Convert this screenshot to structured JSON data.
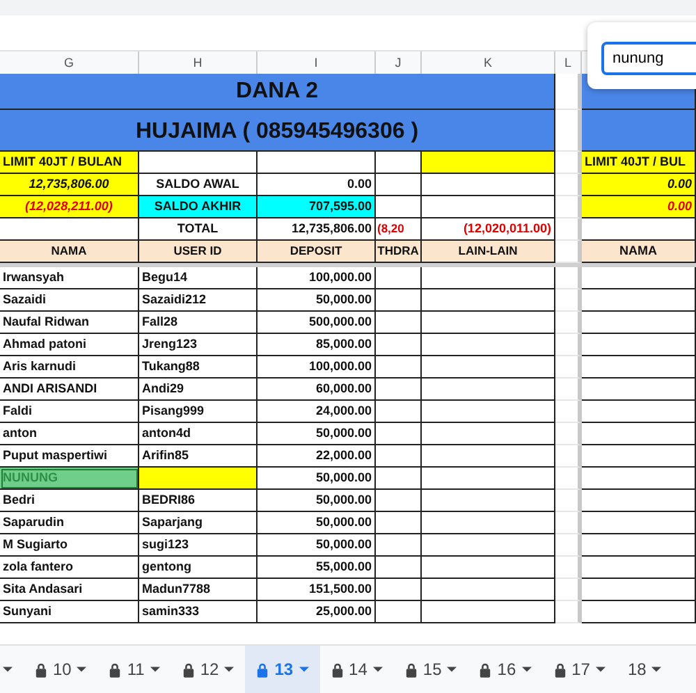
{
  "columns": [
    "G",
    "H",
    "I",
    "J",
    "K",
    "L"
  ],
  "title": "DANA 2",
  "subtitle": "HUJAIMA ( 085945496306 )",
  "limit": "LIMIT 40JT / BULAN",
  "balance_rows": [
    {
      "amount": "12,735,806.00",
      "negative": false,
      "label": "SALDO AWAL",
      "highlight": false,
      "value": "0.00"
    },
    {
      "amount": "(12,028,211.00)",
      "negative": true,
      "label": "SALDO AKHIR",
      "highlight": true,
      "value": "707,595.00"
    }
  ],
  "total": {
    "label": "TOTAL",
    "value": "12,735,806.00",
    "withdraw": "(8,20",
    "other": "(12,020,011.00)"
  },
  "headers": [
    "NAMA",
    "USER ID",
    "DEPOSIT",
    "THDRA",
    "LAIN-LAIN"
  ],
  "rows": [
    {
      "name": "Irwansyah",
      "user_id": "Begu14",
      "deposit": "100,000.00",
      "selected": false,
      "flagged": false
    },
    {
      "name": "Sazaidi",
      "user_id": "Sazaidi212",
      "deposit": "50,000.00",
      "selected": false,
      "flagged": false
    },
    {
      "name": "Naufal Ridwan",
      "user_id": "Fall28",
      "deposit": "500,000.00",
      "selected": false,
      "flagged": false
    },
    {
      "name": "Ahmad patoni",
      "user_id": "Jreng123",
      "deposit": "85,000.00",
      "selected": false,
      "flagged": false
    },
    {
      "name": "Aris karnudi",
      "user_id": "Tukang88",
      "deposit": "100,000.00",
      "selected": false,
      "flagged": false
    },
    {
      "name": "ANDI ARISANDI",
      "user_id": "Andi29",
      "deposit": "60,000.00",
      "selected": false,
      "flagged": false
    },
    {
      "name": "Faldi",
      "user_id": "Pisang999",
      "deposit": "24,000.00",
      "selected": false,
      "flagged": false
    },
    {
      "name": "anton",
      "user_id": "anton4d",
      "deposit": "50,000.00",
      "selected": false,
      "flagged": false
    },
    {
      "name": "Puput maspertiwi",
      "user_id": "Arifin85",
      "deposit": "22,000.00",
      "selected": false,
      "flagged": false
    },
    {
      "name": "NUNUNG",
      "user_id": "",
      "deposit": "50,000.00",
      "selected": true,
      "flagged": true
    },
    {
      "name": "Bedri",
      "user_id": "BEDRI86",
      "deposit": "50,000.00",
      "selected": false,
      "flagged": false
    },
    {
      "name": "Saparudin",
      "user_id": "Saparjang",
      "deposit": "50,000.00",
      "selected": false,
      "flagged": false
    },
    {
      "name": "M Sugiarto",
      "user_id": "sugi123",
      "deposit": "50,000.00",
      "selected": false,
      "flagged": false
    },
    {
      "name": "zola fantero",
      "user_id": "gentong",
      "deposit": "55,000.00",
      "selected": false,
      "flagged": false
    },
    {
      "name": "Sita Andasari",
      "user_id": "Madun7788",
      "deposit": "151,500.00",
      "selected": false,
      "flagged": false
    },
    {
      "name": "Sunyani",
      "user_id": "samin333",
      "deposit": "25,000.00",
      "selected": false,
      "flagged": false
    }
  ],
  "right_block": {
    "limit": "LIMIT 40JT / BUL",
    "values": [
      {
        "text": "0.00",
        "negative": false
      },
      {
        "text": "0.00",
        "negative": true
      }
    ],
    "header": "NAMA"
  },
  "search": {
    "value": "nunung"
  },
  "sheet_tabs": [
    {
      "label": "10",
      "locked": true,
      "selected": false
    },
    {
      "label": "11",
      "locked": true,
      "selected": false
    },
    {
      "label": "12",
      "locked": true,
      "selected": false
    },
    {
      "label": "13",
      "locked": true,
      "selected": true
    },
    {
      "label": "14",
      "locked": true,
      "selected": false
    },
    {
      "label": "15",
      "locked": true,
      "selected": false
    },
    {
      "label": "16",
      "locked": true,
      "selected": false
    },
    {
      "label": "17",
      "locked": true,
      "selected": false
    },
    {
      "label": "18",
      "locked": false,
      "selected": false
    }
  ]
}
